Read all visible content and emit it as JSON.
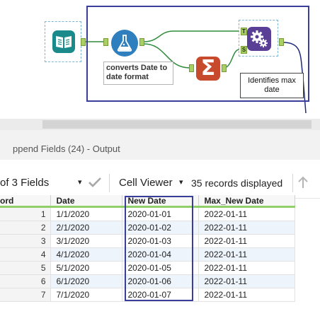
{
  "canvas": {
    "tools": [
      {
        "name": "input-data-tool",
        "icon": "book-icon"
      },
      {
        "name": "formula-tool",
        "icon": "flask-icon"
      },
      {
        "name": "summarize-tool",
        "icon": "sigma-icon"
      },
      {
        "name": "append-fields-tool",
        "icon": "gears-icon"
      }
    ],
    "append_anchors": {
      "target": "T",
      "source": "S"
    },
    "formula_annotation": "converts Date to date format",
    "append_annotation": "Identifies max date",
    "colors": {
      "selection": "#3b3d9a",
      "input_tool": "#1b8a8a",
      "formula_tool": "#2f7fbf",
      "summarize_tool": "#c84a2c",
      "append_tool": "#5a3f97",
      "connector": "#2e8b3a",
      "anchor": "#a8cf63"
    }
  },
  "panel": {
    "title": "ppend Fields (24) - Output"
  },
  "toolbar": {
    "fields_label": "of 3 Fields",
    "fields_caret": "▾",
    "check_icon": "check-icon",
    "cell_viewer_label": "Cell Viewer",
    "cell_viewer_caret": "▾",
    "records_text": "35 records displayed",
    "up_icon": "up-arrow-icon"
  },
  "grid": {
    "columns": [
      "ord",
      "Date",
      "New Date",
      "Max_New Date"
    ],
    "rows": [
      [
        "1",
        "1/1/2020",
        "2020-01-01",
        "2022-01-11"
      ],
      [
        "2",
        "2/1/2020",
        "2020-01-02",
        "2022-01-11"
      ],
      [
        "3",
        "3/1/2020",
        "2020-01-03",
        "2022-01-11"
      ],
      [
        "4",
        "4/1/2020",
        "2020-01-04",
        "2022-01-11"
      ],
      [
        "5",
        "5/1/2020",
        "2020-01-05",
        "2022-01-11"
      ],
      [
        "6",
        "6/1/2020",
        "2020-01-06",
        "2022-01-11"
      ],
      [
        "7",
        "7/1/2020",
        "2020-01-07",
        "2022-01-11"
      ]
    ]
  }
}
